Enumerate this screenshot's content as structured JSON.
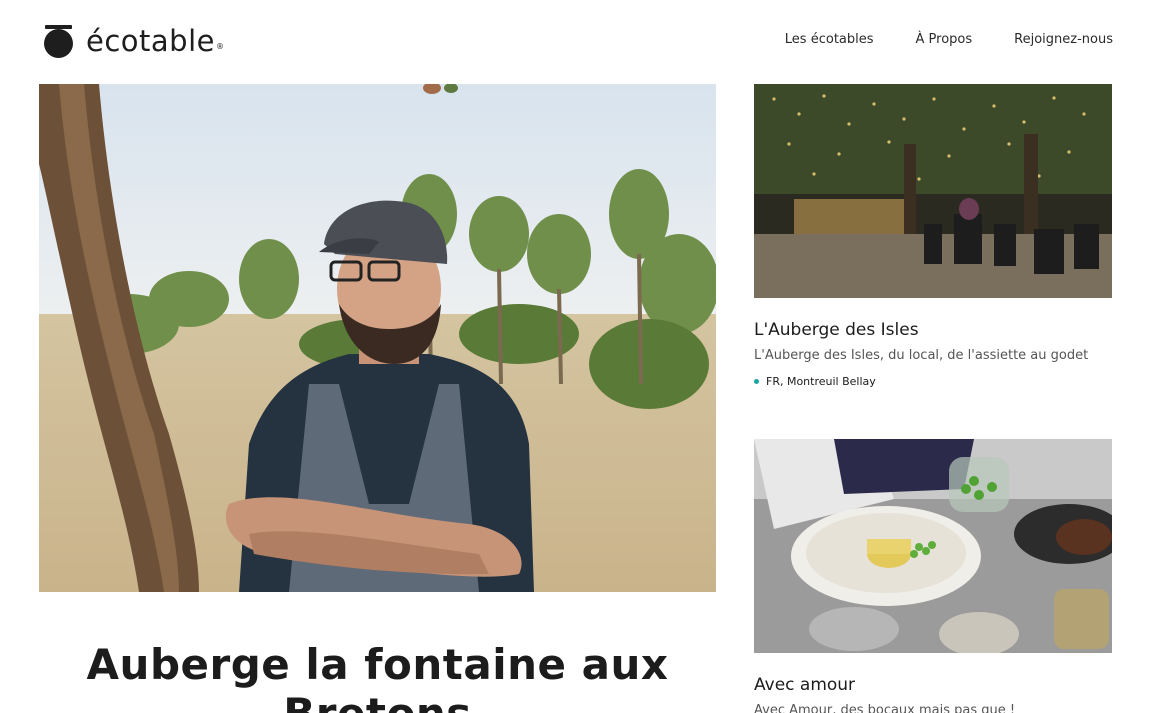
{
  "header": {
    "logo_text": "écotable",
    "logo_reg": "®",
    "nav": [
      {
        "label": "Les écotables"
      },
      {
        "label": "À Propos"
      },
      {
        "label": "Rejoignez-nous"
      }
    ]
  },
  "hero": {
    "title": "Auberge la fontaine aux Bretons"
  },
  "cards": [
    {
      "title": "L'Auberge des Isles",
      "subtitle": "L'Auberge des Isles, du local, de l'assiette au godet",
      "location": "FR, Montreuil Bellay"
    },
    {
      "title": "Avec amour",
      "subtitle": "Avec Amour, des bocaux mais pas que !",
      "location": ""
    }
  ],
  "colors": {
    "accent_dot": "#1aa6a0",
    "text": "#1c1c1c"
  }
}
